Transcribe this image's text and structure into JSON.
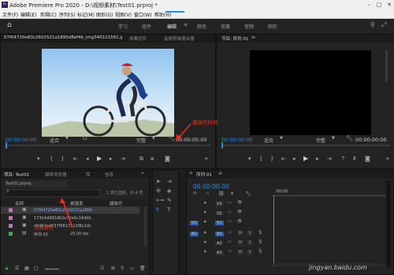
{
  "window": {
    "title": "Adobe Premiere Pro 2020 - D:\\视频素材\\Test01.prproj *",
    "logo": "Pr"
  },
  "menu": [
    "文件(F)",
    "编辑(E)",
    "剪辑(C)",
    "序列(S)",
    "标记(M)",
    "图形(G)",
    "视图(V)",
    "窗口(W)",
    "帮助(H)"
  ],
  "workspaces": [
    "学习",
    "组件",
    "编辑",
    "颜色",
    "效果",
    "音频",
    "图形"
  ],
  "active_workspace": "编辑",
  "source_panel": {
    "tabs": [
      "57f04720e83c2602521a1895d8ef4b_img340121561.jp",
      "效果控件",
      "音频剪辑混合器"
    ],
    "timecode_in": "00:00:00:00",
    "fit": "适合",
    "quality": "完整",
    "timecode_out": "00:00:05:00",
    "annotation": "播放的时间"
  },
  "program_panel": {
    "tab": "节目: 序列 01",
    "timecode_in": "00:00:00:00",
    "fit": "适合",
    "quality": "完整",
    "timecode_out": "00:00:00:00"
  },
  "project_panel": {
    "tabs": [
      "项目: Test01",
      "媒体浏览器",
      "库",
      "信息"
    ],
    "file": "Test01.prproj",
    "selection_info": "1 项已选择，共 4 项",
    "columns": [
      "名称",
      "帧速率",
      "媒体开"
    ],
    "items": [
      {
        "name": "57f04720e83c2602521a1895",
        "rate": ""
      },
      {
        "name": "173b4d992d62e72e9c14d0b",
        "rate": ""
      },
      {
        "name": "db952ad537f9617512f8c2dc",
        "rate": ""
      },
      {
        "name": "序列 01",
        "rate": "25.00 fps"
      }
    ],
    "annotation": "点击素材"
  },
  "timeline_panel": {
    "tab": "序列 01",
    "timecode": "00:00:00:00",
    "ruler": ":00:00",
    "tracks": [
      "V3",
      "V2",
      "V1",
      "A1",
      "A2",
      "A3"
    ],
    "source_patch": [
      "V1",
      "A1"
    ]
  },
  "watermark": "jingyan.baidu.com",
  "colors": {
    "accent": "#2d8ceb",
    "annotation": "#ff2a1a",
    "swatch_image": "#c26fc4",
    "swatch_seq": "#3da84a"
  }
}
